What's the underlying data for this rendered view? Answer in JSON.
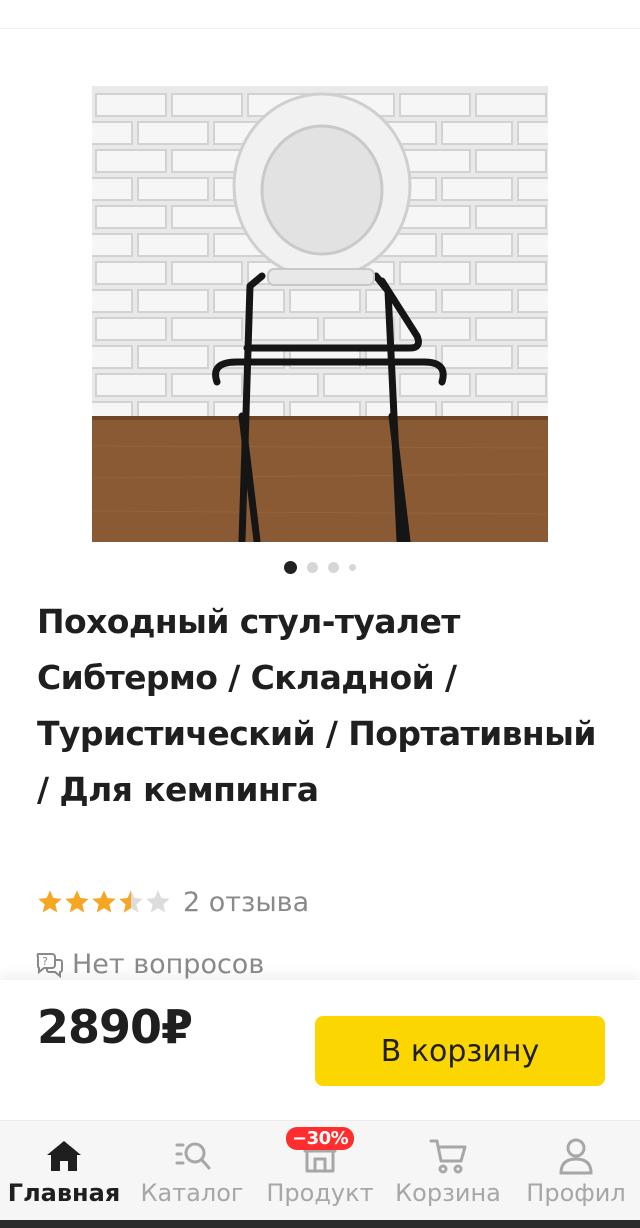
{
  "product": {
    "title": "Походный стул-туалет Сибтермо / Складной / Туристический / Портативный / Для кемпинга",
    "rating_value": 3.5,
    "rating_max": 5,
    "reviews": "2 отзыва",
    "questions": "Нет вопросов",
    "price": "2890₽",
    "image_count": 4,
    "active_image": 1
  },
  "actions": {
    "add_to_cart": "В корзину"
  },
  "nav": {
    "items": [
      {
        "label": "Главная",
        "icon": "home-icon",
        "active": true
      },
      {
        "label": "Каталог",
        "icon": "catalog-search-icon",
        "active": false
      },
      {
        "label": "Продукт",
        "icon": "grocery-store-icon",
        "active": false,
        "badge": "−30%"
      },
      {
        "label": "Корзина",
        "icon": "cart-icon",
        "active": false
      },
      {
        "label": "Профил",
        "icon": "profile-icon",
        "active": false
      }
    ]
  },
  "colors": {
    "accent": "#fcd600",
    "star": "#f5a623",
    "star_empty": "#dcdcdc",
    "badge": "#ff2d2d",
    "text": "#1f1f1f",
    "muted": "#8a8a8a"
  }
}
